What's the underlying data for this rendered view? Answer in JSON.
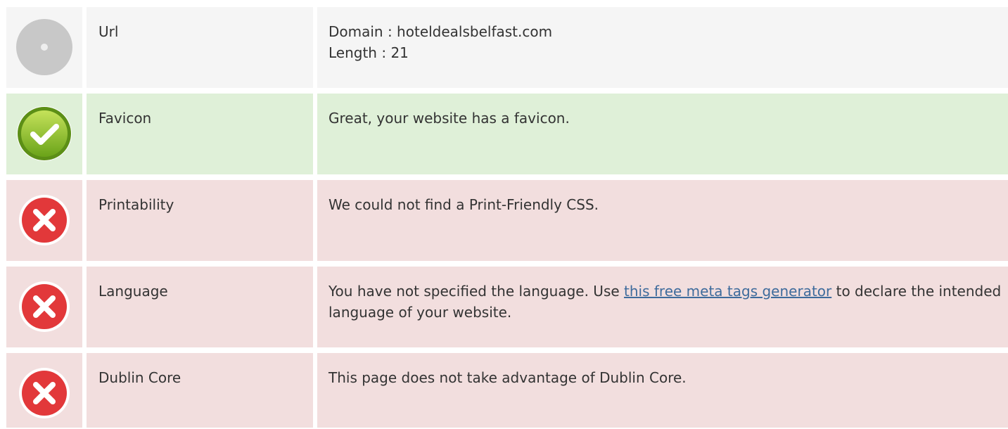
{
  "rows": [
    {
      "status": "neutral",
      "icon": "neutral-dot-icon",
      "label": "Url",
      "lines": [
        "Domain : hoteldealsbelfast.com",
        "Length : 21"
      ]
    },
    {
      "status": "pass",
      "icon": "check-icon",
      "label": "Favicon",
      "text": "Great, your website has a favicon."
    },
    {
      "status": "fail",
      "icon": "error-x-icon",
      "label": "Printability",
      "text": "We could not find a Print-Friendly CSS."
    },
    {
      "status": "fail",
      "icon": "error-x-icon",
      "label": "Language",
      "text_before": "You have not specified the language. Use ",
      "link_text": "this free meta tags generator",
      "text_after": " to declare the intended language of your website."
    },
    {
      "status": "fail",
      "icon": "error-x-icon",
      "label": "Dublin Core",
      "text": "This page does not take advantage of Dublin Core."
    }
  ],
  "colors": {
    "neutral_bg": "#f5f5f5",
    "pass_bg": "#dff0d8",
    "fail_bg": "#f2dede",
    "link": "#3e6b9c"
  }
}
